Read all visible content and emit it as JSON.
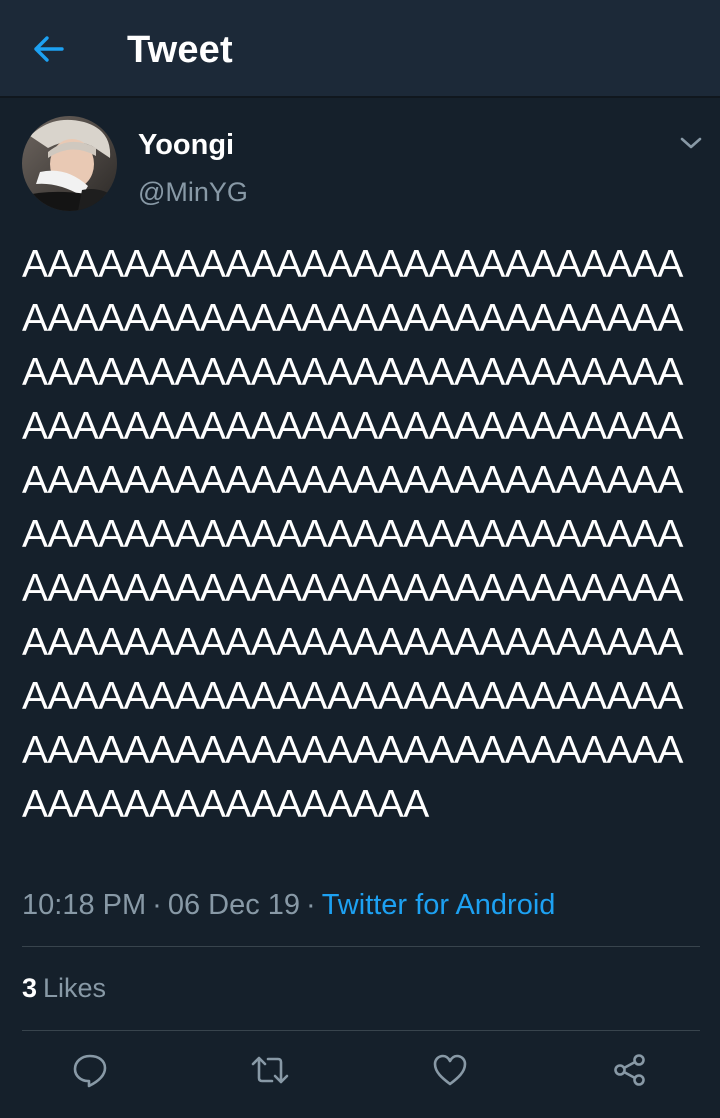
{
  "header": {
    "title": "Tweet",
    "back_icon": "arrow-left-icon",
    "accent_color": "#1da1f2"
  },
  "tweet": {
    "author": {
      "display_name": "Yoongi",
      "handle": "@MinYG",
      "avatar_icon": "avatar-photo"
    },
    "caret_icon": "chevron-down-icon",
    "text": "AAAAAAAAAAAAAAAAAAAAAAAAAAAAAAAAAAAAAAAAAAAAAAAAAAAAAAAAAAAAAAAAAAAAAAAAAAAAAAAAAAAAAAAAAAAAAAAAAAAAAAAAAAAAAAAAAAAAAAAAAAAAAAAAAAAAAAAAAAAAAAAAAAAAAAAAAAAAAAAAAAAAAAAAAAAAAAAAAAAAAAAAAAAAAAAAAAAAAAAAAAAAAAAAAAAAAAAAAAAAAAAAAAAAAAAAAAAAAAAAAAAAAAAAAAAAAAAAAAAAAAAAAAAAAAAAAAAA",
    "time": "10:18 PM",
    "date": "06 Dec 19",
    "separator": "·",
    "source": "Twitter for Android",
    "likes_count": "3",
    "likes_label": "Likes"
  },
  "actions": [
    {
      "name": "reply",
      "icon": "reply-icon"
    },
    {
      "name": "retweet",
      "icon": "retweet-icon"
    },
    {
      "name": "like",
      "icon": "heart-icon"
    },
    {
      "name": "share",
      "icon": "share-icon"
    }
  ],
  "colors": {
    "background": "#15202b",
    "header_background": "#1c2938",
    "secondary_text": "#8899a6",
    "divider": "#38444d",
    "link": "#1da1f2"
  }
}
